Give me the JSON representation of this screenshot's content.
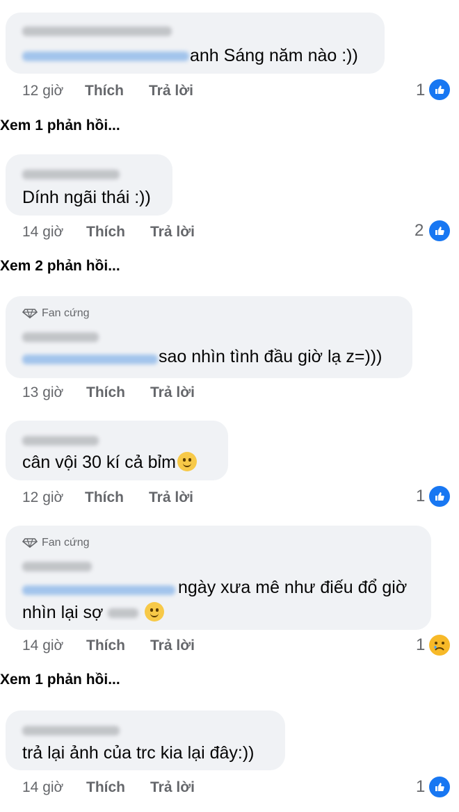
{
  "comments": [
    {
      "text": "anh Sáng năm nào :))",
      "time": "12 giờ",
      "like": "Thích",
      "reply": "Trả lời",
      "reaction_count": "1",
      "view_replies": "Xem 1 phản hồi..."
    },
    {
      "text": "Dính ngãi thái :))",
      "time": "14 giờ",
      "like": "Thích",
      "reply": "Trả lời",
      "reaction_count": "2",
      "view_replies": "Xem 2 phản hồi..."
    },
    {
      "badge": "Fan cứng",
      "text": "sao nhìn tình đầu giờ lạ z=)))",
      "time": "13 giờ",
      "like": "Thích",
      "reply": "Trả lời"
    },
    {
      "text": "cân vội 30 kí cả bỉm",
      "time": "12 giờ",
      "like": "Thích",
      "reply": "Trả lời",
      "reaction_count": "1"
    },
    {
      "badge": "Fan cứng",
      "text_line1": "ngày xưa mê như điếu đổ giờ",
      "text_line2": "nhìn lại sợ",
      "time": "14 giờ",
      "like": "Thích",
      "reply": "Trả lời",
      "reaction_count": "1",
      "view_replies": "Xem 1 phản hồi..."
    },
    {
      "text": "trả lại ảnh của trc kia lại đây:))",
      "time": "14 giờ",
      "like": "Thích",
      "reply": "Trả lời",
      "reaction_count": "1"
    }
  ],
  "icons": {
    "like": "thumbs-up-icon",
    "sad": "sad-face-icon",
    "badge": "diamond-icon",
    "emoji": "smiling-face-icon"
  },
  "colors": {
    "bubble": "#f0f2f5",
    "like_blue": "#1877f2",
    "meta": "#65676b"
  }
}
